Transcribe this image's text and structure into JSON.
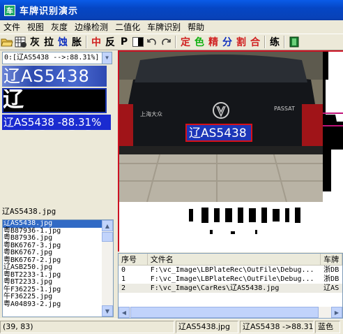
{
  "window": {
    "title": "车牌识别演示",
    "app_icon_glyph": "车"
  },
  "menu": [
    "文件",
    "视图",
    "灰度",
    "边缘检测",
    "二值化",
    "车牌识别",
    "帮助"
  ],
  "toolbar": {
    "gray": "灰",
    "stretch": "拉",
    "erode": "蚀",
    "dilate": "胀",
    "median": "中",
    "invert": "反",
    "p": "P",
    "locate": "定",
    "color": "色",
    "refine": "精",
    "split": "分",
    "cut": "割",
    "merge": "合",
    "train": "练"
  },
  "left": {
    "combo_value": "0:[辽AS5438 -->:88.31%]",
    "plate_gray_text": "辽AS5438",
    "plate_binary_text": "辽AS5438",
    "result_text": "辽AS5438 -88.31%",
    "current_file": "辽AS5438.jpg",
    "files": [
      "辽AS5438.jpg",
      "粤B87936-1.jpg",
      "粤B87936.jpg",
      "粤BK6767-3.jpg",
      "粤BK6767.jpg",
      "粤BK6767-2.jpg",
      "辽ASB250.jpg",
      "粤BT2233-1.jpg",
      "粤BT2233.jpg",
      "午F36225-1.jpg",
      "午F36225.jpg",
      "粤A04893-2.jpg"
    ]
  },
  "image": {
    "plate_text": "辽AS5438",
    "car_badge": "上海大众",
    "car_model": "PASSAT"
  },
  "table": {
    "headers": [
      "序号",
      "文件名",
      "车牌"
    ],
    "rows": [
      {
        "idx": "0",
        "file": "F:\\vc_Image\\LBPlateRec\\OutFile\\Debug...",
        "plate": "浙DB"
      },
      {
        "idx": "1",
        "file": "F:\\vc_Image\\LBPlateRec\\OutFile\\Debug...",
        "plate": "浙DB"
      },
      {
        "idx": "2",
        "file": "F:\\vc_Image\\CarRes\\辽AS5438.jpg",
        "plate": "辽AS"
      }
    ]
  },
  "status": {
    "coords": "(39, 83)",
    "file": "辽AS5438.jpg",
    "result": "辽AS5438 ->88.31%",
    "color": "蓝色"
  }
}
